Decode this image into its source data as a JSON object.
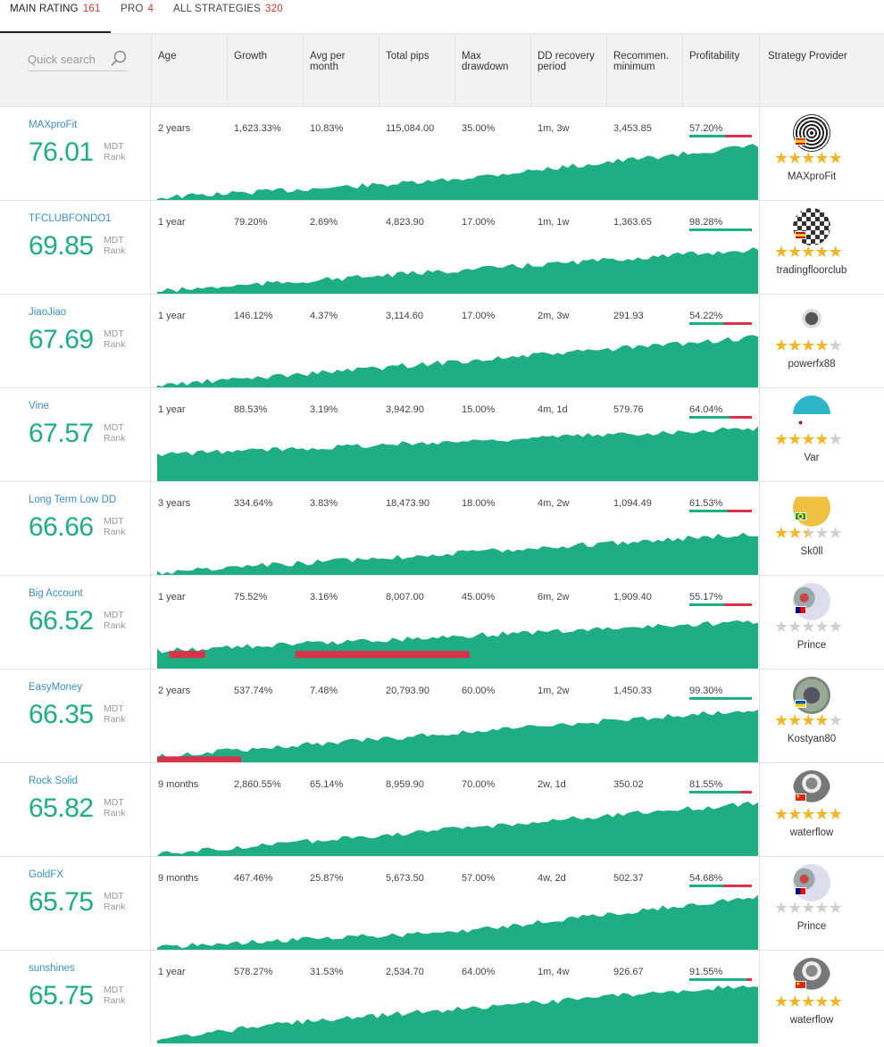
{
  "tabs": [
    {
      "label": "MAIN RATING",
      "count": "161"
    },
    {
      "label": "PRO",
      "count": "4"
    },
    {
      "label": "ALL STRATEGIES",
      "count": "320"
    }
  ],
  "search": {
    "placeholder": "Quick search"
  },
  "columns": {
    "age": "Age",
    "growth": "Growth",
    "avg1": "Avg per",
    "avg2": "month",
    "pips": "Total pips",
    "dd1": "Max",
    "dd2": "drawdown",
    "rec1": "DD recovery",
    "rec2": "period",
    "min1": "Recommen.",
    "min2": "minimum",
    "profit": "Profitability",
    "provider": "Strategy Provider"
  },
  "mdt_label": "MDT",
  "rank_label": "Rank",
  "colors": {
    "green": "#1fae84",
    "red": "#d8334a",
    "link": "#3c8fc7",
    "star": "#f2b526"
  },
  "rows": [
    {
      "name": "MAXproFit",
      "score": "76.01",
      "age": "2 years",
      "growth": "1,623.33%",
      "avg": "10.83%",
      "pips": "115,084.00",
      "dd": "35.00%",
      "recovery": "1m, 3w",
      "minimum": "3,453.85",
      "profit": "57.20%",
      "profit_value": 0.572,
      "provider": "MAXproFit",
      "stars": 5,
      "flag": "es",
      "avatar": "spiral-icon"
    },
    {
      "name": "TFCLUBFONDO1",
      "score": "69.85",
      "age": "1 year",
      "growth": "79.20%",
      "avg": "2.69%",
      "pips": "4,823.90",
      "dd": "17.00%",
      "recovery": "1m, 1w",
      "minimum": "1,363.65",
      "profit": "98.28%",
      "profit_value": 0.9828,
      "provider": "tradingfloorclub",
      "stars": 5,
      "flag": "es",
      "avatar": "qr-icon"
    },
    {
      "name": "JiaoJiao",
      "score": "67.69",
      "age": "1 year",
      "growth": "146.12%",
      "avg": "4.37%",
      "pips": "3,114.60",
      "dd": "17.00%",
      "recovery": "2m, 3w",
      "minimum": "291.93",
      "profit": "54.22%",
      "profit_value": 0.5422,
      "provider": "powerfx88",
      "stars": 4,
      "flag": "",
      "avatar": "bird-icon"
    },
    {
      "name": "Vine",
      "score": "67.57",
      "age": "1 year",
      "growth": "88.53%",
      "avg": "3.19%",
      "pips": "3,942.90",
      "dd": "15.00%",
      "recovery": "4m, 1d",
      "minimum": "579.76",
      "profit": "64.04%",
      "profit_value": 0.6404,
      "provider": "Var",
      "stars": 4,
      "flag": "jp",
      "avatar": "gauge-icon"
    },
    {
      "name": "Long Term Low DD",
      "score": "66.66",
      "age": "3 years",
      "growth": "334.64%",
      "avg": "3.83%",
      "pips": "18,473.90",
      "dd": "18.00%",
      "recovery": "4m, 2w",
      "minimum": "1,094.49",
      "profit": "61.53%",
      "profit_value": 0.6153,
      "provider": "Sk0ll",
      "stars": 2.5,
      "flag": "br",
      "avatar": "coins-chart-icon"
    },
    {
      "name": "Big Account",
      "score": "66.52",
      "age": "1 year",
      "growth": "75.52%",
      "avg": "3.16%",
      "pips": "8,007.00",
      "dd": "45.00%",
      "recovery": "6m, 2w",
      "minimum": "1,909.40",
      "profit": "55.17%",
      "profit_value": 0.5517,
      "provider": "Prince",
      "stars": 0,
      "flag": "tw",
      "avatar": "floral-icon"
    },
    {
      "name": "EasyMoney",
      "score": "66.35",
      "age": "2 years",
      "growth": "537.74%",
      "avg": "7.48%",
      "pips": "20,793.90",
      "dd": "60.00%",
      "recovery": "1m, 2w",
      "minimum": "1,450.33",
      "profit": "99.30%",
      "profit_value": 0.993,
      "provider": "Kostyan80",
      "stars": 4,
      "flag": "ua",
      "avatar": "banknote-icon"
    },
    {
      "name": "Rock Solid",
      "score": "65.82",
      "age": "9 months",
      "growth": "2,860.55%",
      "avg": "65.14%",
      "pips": "8,959.90",
      "dd": "70.00%",
      "recovery": "2w, 1d",
      "minimum": "350.02",
      "profit": "81.55%",
      "profit_value": 0.8155,
      "provider": "waterflow",
      "stars": 5,
      "flag": "cn",
      "avatar": "suit-man-icon"
    },
    {
      "name": "GoldFX",
      "score": "65.75",
      "age": "9 months",
      "growth": "467.46%",
      "avg": "25.87%",
      "pips": "5,673.50",
      "dd": "57.00%",
      "recovery": "4w, 2d",
      "minimum": "502.37",
      "profit": "54.68%",
      "profit_value": 0.5468,
      "provider": "Prince",
      "stars": 0,
      "flag": "tw",
      "avatar": "floral-icon"
    },
    {
      "name": "sunshines",
      "score": "65.75",
      "age": "1 year",
      "growth": "578.27%",
      "avg": "31.53%",
      "pips": "2,534.70",
      "dd": "64.00%",
      "recovery": "1m, 4w",
      "minimum": "926.67",
      "profit": "91.55%",
      "profit_value": 0.9155,
      "provider": "waterflow",
      "stars": 5,
      "flag": "cn",
      "avatar": "suit-man-icon"
    }
  ]
}
